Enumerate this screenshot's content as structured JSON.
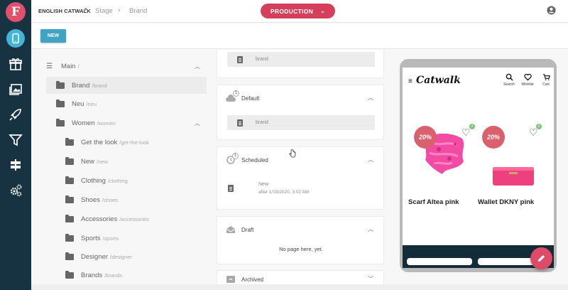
{
  "app": {
    "logo_letter": "F"
  },
  "sidebar": {
    "icons": [
      "mobile-icon",
      "gift-icon",
      "gallery-icon",
      "rocket-icon",
      "filter-icon",
      "signpost-icon",
      "gears-icon"
    ],
    "active": "mobile-icon",
    "colors": {
      "bg": "#173240",
      "active": "#43b3d6",
      "logo": "#e0506b"
    }
  },
  "header": {
    "site": "ENGLISH CATWALK",
    "crumbs": [
      "Stage",
      "Brand"
    ],
    "environment": "PRODUCTION",
    "colors": {
      "environment": "#d63f5c"
    }
  },
  "toolbar": {
    "new_label": "NEW"
  },
  "tree": {
    "root": {
      "label": "Main",
      "slug": "/"
    },
    "items": [
      {
        "label": "Brand",
        "slug": "/brand",
        "selected": true
      },
      {
        "label": "Neu",
        "slug": "/neu"
      },
      {
        "label": "Women",
        "slug": "/women",
        "expanded": true
      },
      {
        "label": "Get the look",
        "slug": "/get-the-look"
      },
      {
        "label": "New",
        "slug": "/new"
      },
      {
        "label": "Clothing",
        "slug": "/clothing"
      },
      {
        "label": "Shoes",
        "slug": "/shoes"
      },
      {
        "label": "Accessories",
        "slug": "/accessories"
      },
      {
        "label": "Sports",
        "slug": "/sports"
      },
      {
        "label": "Designer",
        "slug": "/designer"
      },
      {
        "label": "Brands",
        "slug": "/brands"
      }
    ]
  },
  "versions": {
    "top_item": "brand",
    "default": {
      "title": "Default",
      "item": "brand"
    },
    "scheduled": {
      "title": "Scheduled",
      "badge": "1",
      "item": "New",
      "item_sub": "after 1/19/2020, 3:02 AM"
    },
    "draft": {
      "title": "Draft",
      "empty": "No page here, yet."
    },
    "archived": {
      "title": "Archived"
    },
    "default_badge": "1"
  },
  "preview": {
    "logo": "Catwalk",
    "actions": [
      "Search",
      "Wishlist",
      "Cart"
    ],
    "products": [
      {
        "name": "Scarf Altea pink",
        "discount": "20%",
        "wishlist_count": "2"
      },
      {
        "name": "Wallet DKNY pink",
        "discount": "20%",
        "wishlist_count": "2"
      }
    ]
  }
}
